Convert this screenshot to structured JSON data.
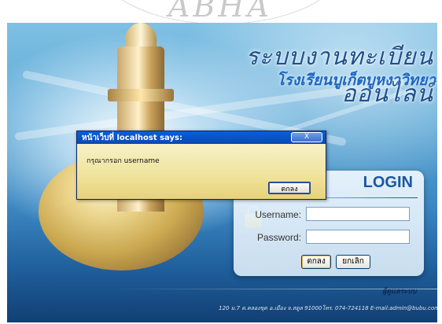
{
  "watermark": "ABHA",
  "banner": {
    "system_title": "ระบบงานทะเบียนออนไลน์",
    "school_name": "โรงเรียนบูเก็ตบูหงาวิทยา"
  },
  "login": {
    "heading": "LOGIN",
    "username_label": "Username:",
    "username_value": "",
    "password_label": "Password:",
    "password_value": "",
    "ok_button": "ตกลง",
    "cancel_button": "ยกเลิก",
    "admin_link": "ผู้ดูแลระบบ"
  },
  "footer": {
    "address": "120 ม.7 ต.คลองขุด อ.เมือง จ.สตูล 91000โทร. 074-724118 E-mail:admin@bubu.com"
  },
  "dialog": {
    "title": "หน้าเว็บที่ localhost says:",
    "close_label": "X",
    "message": "กรุณากรอก username",
    "ok_button": "ตกลง"
  },
  "colors": {
    "heading_blue": "#1c56a0",
    "dialog_title_blue": "#0a5fd8",
    "dialog_body": "#efe29a"
  }
}
